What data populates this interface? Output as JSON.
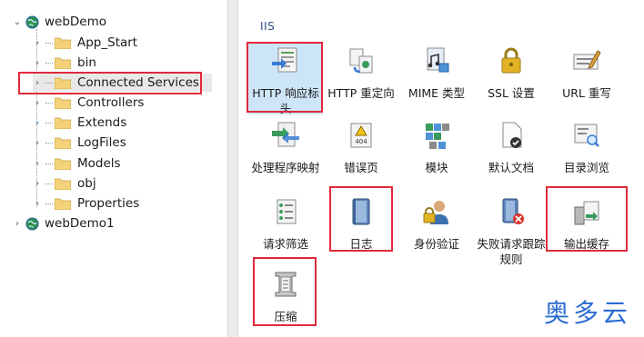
{
  "tree": {
    "projects": [
      {
        "label": "webDemo",
        "expanded": true
      },
      {
        "label": "webDemo1",
        "expanded": false
      }
    ],
    "items": [
      {
        "label": "App_Start"
      },
      {
        "label": "bin"
      },
      {
        "label": "Connected Services"
      },
      {
        "label": "Controllers"
      },
      {
        "label": "Extends"
      },
      {
        "label": "LogFiles"
      },
      {
        "label": "Models"
      },
      {
        "label": "obj"
      },
      {
        "label": "Properties"
      }
    ]
  },
  "iis": {
    "title": "IIS",
    "features": [
      {
        "label": "HTTP 响应标头",
        "icon": "http-headers-icon"
      },
      {
        "label": "HTTP 重定向",
        "icon": "http-redirect-icon"
      },
      {
        "label": "MIME 类型",
        "icon": "mime-types-icon"
      },
      {
        "label": "SSL 设置",
        "icon": "ssl-lock-icon"
      },
      {
        "label": "URL 重写",
        "icon": "url-rewrite-icon"
      },
      {
        "label": "处理程序映射",
        "icon": "handler-mappings-icon"
      },
      {
        "label": "错误页",
        "icon": "error-pages-icon"
      },
      {
        "label": "模块",
        "icon": "modules-icon"
      },
      {
        "label": "默认文档",
        "icon": "default-document-icon"
      },
      {
        "label": "目录浏览",
        "icon": "directory-browsing-icon"
      },
      {
        "label": "请求筛选",
        "icon": "request-filtering-icon"
      },
      {
        "label": "日志",
        "icon": "logging-icon"
      },
      {
        "label": "身份验证",
        "icon": "authentication-icon"
      },
      {
        "label": "失败请求跟踪规则",
        "icon": "failed-request-tracing-icon"
      },
      {
        "label": "输出缓存",
        "icon": "output-caching-icon"
      },
      {
        "label": "压缩",
        "icon": "compression-icon"
      }
    ]
  },
  "error_icon_text": "404",
  "watermark": "奥多云",
  "colors": {
    "highlight": "#e0293a",
    "selection": "#cde6f7",
    "folder": "#f3d27a"
  }
}
